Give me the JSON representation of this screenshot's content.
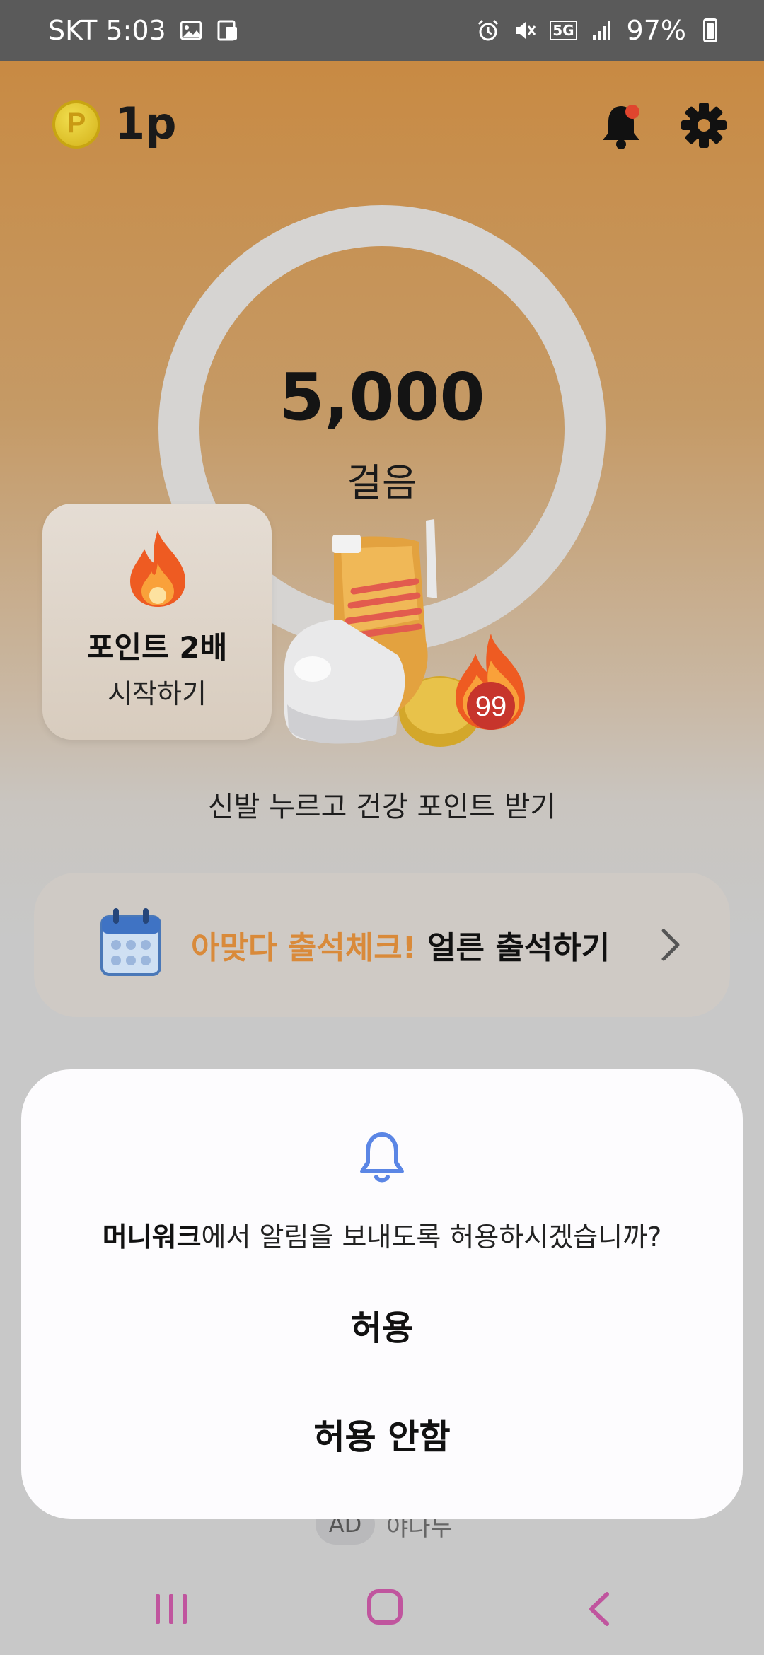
{
  "status_bar": {
    "carrier_time": "SKT 5:03",
    "battery": "97%",
    "network": "5G"
  },
  "header": {
    "coin_letter": "P",
    "points": "1p",
    "icons": [
      "bell-icon",
      "gear-icon"
    ]
  },
  "steps": {
    "value": "5,000",
    "unit": "걸음"
  },
  "double_points_card": {
    "title": "포인트 2배",
    "subtitle": "시작하기"
  },
  "shoe_badge": "99",
  "tap_caption": "신발 누르고 건강 포인트 받기",
  "attendance": {
    "highlight": "아맞다 출석체크!",
    "action": " 얼른 출석하기"
  },
  "ad": {
    "label": "AD",
    "text": "야나두"
  },
  "permission_sheet": {
    "app_name": "머니워크",
    "question": "에서 알림을 보내도록 허용하시겠습니까?",
    "allow": "허용",
    "deny": "허용 안함"
  },
  "colors": {
    "accent_orange": "#d98a3a",
    "header_bg": "#c88a43",
    "sheet_bell": "#5b86e5",
    "nav_icons": "#c0559e"
  }
}
